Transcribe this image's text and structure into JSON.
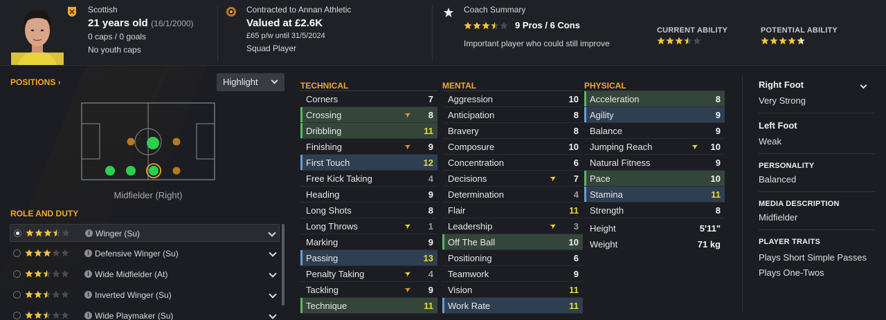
{
  "header": {
    "nationality": "Scottish",
    "age": "21 years old",
    "dob": "(16/1/2000)",
    "caps_goals": "0 caps / 0 goals",
    "youth_caps": "No youth caps",
    "contract": "Contracted to Annan Athletic",
    "value": "Valued at £2.6K",
    "wage": "£65 p/w until 31/5/2024",
    "squad_status": "Squad Player",
    "coach_summary_label": "Coach Summary",
    "pros_cons": "9 Pros / 6 Cons",
    "coach_comment": "Important player who could still improve",
    "current_ability_label": "CURRENT ABILITY",
    "potential_ability_label": "POTENTIAL ABILITY",
    "coach_stars": 3.5,
    "current_ability_stars": 3.5,
    "potential_ability_stars": 4.5
  },
  "positions": {
    "title": "POSITIONS",
    "highlight_label": "Highlight",
    "position_name": "Midfielder (Right)"
  },
  "role_duty": {
    "title": "ROLE AND DUTY",
    "roles": [
      {
        "label": "Winger (Su)",
        "stars": 3.5,
        "selected": true
      },
      {
        "label": "Defensive Winger (Su)",
        "stars": 3,
        "selected": false
      },
      {
        "label": "Wide Midfielder (At)",
        "stars": 2.5,
        "selected": false
      },
      {
        "label": "Inverted Winger (Su)",
        "stars": 2.5,
        "selected": false
      },
      {
        "label": "Wide Playmaker (Su)",
        "stars": 2.5,
        "selected": false
      }
    ]
  },
  "technical": {
    "title": "TECHNICAL",
    "attrs": [
      {
        "name": "Corners",
        "value": "7",
        "hl": "",
        "arrow": ""
      },
      {
        "name": "Crossing",
        "value": "8",
        "hl": "g",
        "arrow": "up"
      },
      {
        "name": "Dribbling",
        "value": "11",
        "hl": "g",
        "arrow": ""
      },
      {
        "name": "Finishing",
        "value": "9",
        "hl": "",
        "arrow": "up"
      },
      {
        "name": "First Touch",
        "value": "12",
        "hl": "b",
        "arrow": ""
      },
      {
        "name": "Free Kick Taking",
        "value": "4",
        "hl": "",
        "arrow": ""
      },
      {
        "name": "Heading",
        "value": "9",
        "hl": "",
        "arrow": ""
      },
      {
        "name": "Long Shots",
        "value": "8",
        "hl": "",
        "arrow": ""
      },
      {
        "name": "Long Throws",
        "value": "1",
        "hl": "",
        "arrow": "ye"
      },
      {
        "name": "Marking",
        "value": "9",
        "hl": "",
        "arrow": ""
      },
      {
        "name": "Passing",
        "value": "13",
        "hl": "b",
        "arrow": ""
      },
      {
        "name": "Penalty Taking",
        "value": "4",
        "hl": "",
        "arrow": "ye"
      },
      {
        "name": "Tackling",
        "value": "9",
        "hl": "",
        "arrow": "up"
      },
      {
        "name": "Technique",
        "value": "11",
        "hl": "g",
        "arrow": ""
      }
    ]
  },
  "mental": {
    "title": "MENTAL",
    "attrs": [
      {
        "name": "Aggression",
        "value": "10",
        "hl": "",
        "arrow": ""
      },
      {
        "name": "Anticipation",
        "value": "8",
        "hl": "",
        "arrow": ""
      },
      {
        "name": "Bravery",
        "value": "8",
        "hl": "",
        "arrow": ""
      },
      {
        "name": "Composure",
        "value": "10",
        "hl": "",
        "arrow": ""
      },
      {
        "name": "Concentration",
        "value": "6",
        "hl": "",
        "arrow": ""
      },
      {
        "name": "Decisions",
        "value": "7",
        "hl": "",
        "arrow": "ye"
      },
      {
        "name": "Determination",
        "value": "4",
        "hl": "",
        "arrow": ""
      },
      {
        "name": "Flair",
        "value": "11",
        "hl": "",
        "arrow": ""
      },
      {
        "name": "Leadership",
        "value": "3",
        "hl": "",
        "arrow": "ye"
      },
      {
        "name": "Off The Ball",
        "value": "10",
        "hl": "g",
        "arrow": ""
      },
      {
        "name": "Positioning",
        "value": "6",
        "hl": "",
        "arrow": ""
      },
      {
        "name": "Teamwork",
        "value": "9",
        "hl": "",
        "arrow": ""
      },
      {
        "name": "Vision",
        "value": "11",
        "hl": "",
        "arrow": ""
      },
      {
        "name": "Work Rate",
        "value": "11",
        "hl": "b",
        "arrow": ""
      }
    ]
  },
  "physical": {
    "title": "PHYSICAL",
    "attrs": [
      {
        "name": "Acceleration",
        "value": "8",
        "hl": "g",
        "arrow": ""
      },
      {
        "name": "Agility",
        "value": "9",
        "hl": "b",
        "arrow": ""
      },
      {
        "name": "Balance",
        "value": "9",
        "hl": "",
        "arrow": ""
      },
      {
        "name": "Jumping Reach",
        "value": "10",
        "hl": "",
        "arrow": "ye"
      },
      {
        "name": "Natural Fitness",
        "value": "9",
        "hl": "",
        "arrow": ""
      },
      {
        "name": "Pace",
        "value": "10",
        "hl": "g",
        "arrow": ""
      },
      {
        "name": "Stamina",
        "value": "11",
        "hl": "b",
        "arrow": ""
      },
      {
        "name": "Strength",
        "value": "8",
        "hl": "",
        "arrow": ""
      }
    ],
    "height_label": "Height",
    "height_value": "5'11\"",
    "weight_label": "Weight",
    "weight_value": "71 kg"
  },
  "profile": {
    "right_foot_label": "Right Foot",
    "right_foot_value": "Very Strong",
    "left_foot_label": "Left Foot",
    "left_foot_value": "Weak",
    "personality_label": "PERSONALITY",
    "personality_value": "Balanced",
    "media_label": "MEDIA DESCRIPTION",
    "media_value": "Midfielder",
    "traits_label": "PLAYER TRAITS",
    "traits": [
      "Plays Short Simple Passes",
      "Plays One-Twos"
    ]
  },
  "colors": {
    "accent": "#f0a732",
    "green_highlight": "#34463a",
    "blue_highlight": "#2f3f52",
    "value_yellow": "#e4db3a"
  }
}
